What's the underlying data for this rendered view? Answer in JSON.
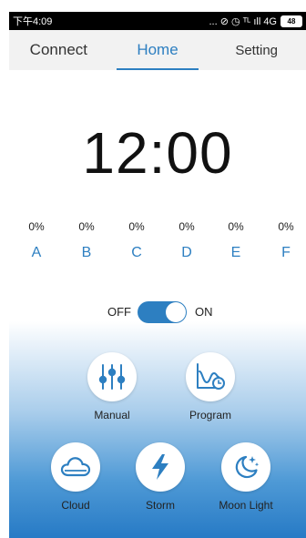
{
  "status_bar": {
    "time": "下午4:09",
    "indicators": "... ⊘ ◷ ᵀᴸ ıll 4G",
    "battery": "48"
  },
  "tabs": [
    {
      "label": "Connect",
      "active": false
    },
    {
      "label": "Home",
      "active": true
    },
    {
      "label": "Setting",
      "active": false
    }
  ],
  "clock": {
    "time": "12:00"
  },
  "channels": [
    {
      "letter": "A",
      "percent": "0%"
    },
    {
      "letter": "B",
      "percent": "0%"
    },
    {
      "letter": "C",
      "percent": "0%"
    },
    {
      "letter": "D",
      "percent": "0%"
    },
    {
      "letter": "E",
      "percent": "0%"
    },
    {
      "letter": "F",
      "percent": "0%"
    }
  ],
  "power": {
    "off_label": "OFF",
    "on_label": "ON",
    "state": "on"
  },
  "modes": {
    "manual": {
      "label": "Manual",
      "icon": "sliders-icon"
    },
    "program": {
      "label": "Program",
      "icon": "program-chart-icon"
    },
    "cloud": {
      "label": "Cloud",
      "icon": "cloud-icon"
    },
    "storm": {
      "label": "Storm",
      "icon": "lightning-icon"
    },
    "moon_light": {
      "label": "Moon Light",
      "icon": "moon-icon"
    }
  },
  "colors": {
    "accent": "#2d7fc1",
    "status_bar": "#000000",
    "tab_bar": "#f2f2f2"
  }
}
